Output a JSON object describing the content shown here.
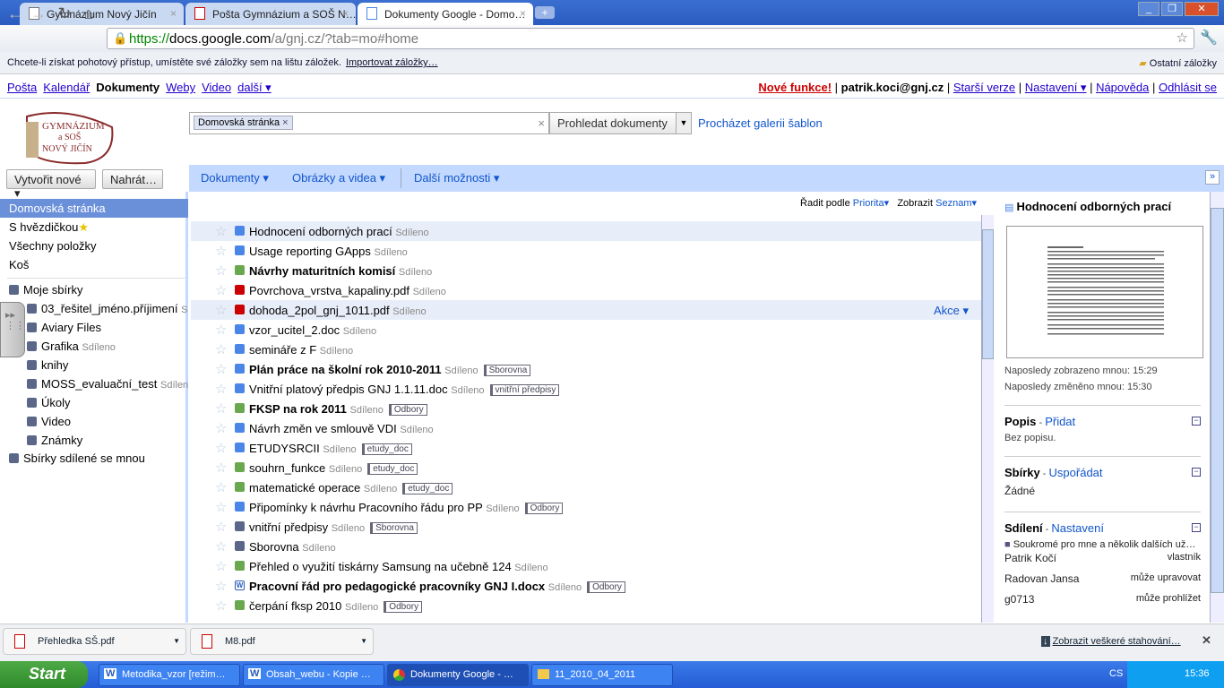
{
  "browser": {
    "tabs": [
      {
        "title": "Gymnázium Nový Jičín",
        "icon": "page-icon"
      },
      {
        "title": "Pošta Gymnázium a SOŠ N…",
        "icon": "gmail-icon"
      },
      {
        "title": "Dokumenty Google - Domo…",
        "icon": "docs-icon"
      }
    ],
    "url": {
      "scheme": "https://",
      "host": "docs.google.com",
      "path": "/a/gnj.cz/?tab=mo#home"
    },
    "bookmark_bar": {
      "text": "Chcete-li získat pohotový přístup, umístěte své záložky sem na lištu záložek.",
      "import": "Importovat záložky…",
      "other": "Ostatní záložky"
    }
  },
  "gbar": {
    "left": [
      "Pošta",
      "Kalendář",
      "Dokumenty",
      "Weby",
      "Video",
      "další ▾"
    ],
    "new": "Nové funkce!",
    "user": "patrik.koci@gnj.cz",
    "links": [
      "Starší verze",
      "Nastavení ▾",
      "Nápověda",
      "Odhlásit se"
    ]
  },
  "logo": {
    "text": "GYMNÁZIUM a SOŠ NOVÝ JIČÍN"
  },
  "search": {
    "chip": "Domovská stránka",
    "button": "Prohledat dokumenty",
    "gallery": "Procházet galerii šablon"
  },
  "actions": {
    "create": "Vytvořit nové ▾",
    "upload": "Nahrát…"
  },
  "menus": [
    "Dokumenty ▾",
    "Obrázky a videa ▾",
    "Další možnosti ▾"
  ],
  "sidebar": {
    "items": [
      "Domovská stránka",
      "S hvězdičkou",
      "Všechny položky",
      "Koš"
    ],
    "collections_title": "Moje sbírky",
    "collections": [
      {
        "name": "03_řešitel_jméno.příjimení",
        "shared": "S"
      },
      {
        "name": "Aviary Files",
        "shared": ""
      },
      {
        "name": "Grafika",
        "shared": "Sdíleno"
      },
      {
        "name": "knihy",
        "shared": ""
      },
      {
        "name": "MOSS_evaluační_test",
        "shared": "Sdílen"
      },
      {
        "name": "Úkoly",
        "shared": ""
      },
      {
        "name": "Video",
        "shared": ""
      },
      {
        "name": "Známky",
        "shared": ""
      }
    ],
    "shared_with_me": "Sbírky sdílené se mnou"
  },
  "list": {
    "sort_label": "Řadit podle",
    "sort_value": "Priorita▾",
    "view_label": "Zobrazit",
    "view_value": "Seznam▾",
    "row_action": "Akce ▾",
    "shared_label": "Sdíleno",
    "rows": [
      {
        "name": "Hodnocení odborných prací",
        "type": "doc",
        "bold": false,
        "tag": ""
      },
      {
        "name": "Usage reporting GApps",
        "type": "doc",
        "bold": false,
        "tag": ""
      },
      {
        "name": "Návrhy maturitních komisí",
        "type": "sheet",
        "bold": true,
        "tag": ""
      },
      {
        "name": "Povrchova_vrstva_kapaliny.pdf",
        "type": "pdf",
        "bold": false,
        "tag": ""
      },
      {
        "name": "dohoda_2pol_gnj_1011.pdf",
        "type": "pdf",
        "bold": false,
        "tag": ""
      },
      {
        "name": "vzor_ucitel_2.doc",
        "type": "doc",
        "bold": false,
        "tag": ""
      },
      {
        "name": "semináře z F",
        "type": "doc",
        "bold": false,
        "tag": ""
      },
      {
        "name": "Plán práce na školní rok 2010-2011",
        "type": "doc",
        "bold": true,
        "tag": "Sborovna"
      },
      {
        "name": "Vnitřní platový předpis GNJ 1.1.11.doc",
        "type": "doc",
        "bold": false,
        "tag": "vnitřní předpisy"
      },
      {
        "name": "FKSP na rok 2011",
        "type": "sheet",
        "bold": true,
        "tag": "Odbory"
      },
      {
        "name": "Návrh změn ve smlouvě VDI",
        "type": "doc",
        "bold": false,
        "tag": ""
      },
      {
        "name": "ETUDYSRCII",
        "type": "doc",
        "bold": false,
        "tag": "etudy_doc"
      },
      {
        "name": "souhrn_funkce",
        "type": "sheet",
        "bold": false,
        "tag": "etudy_doc"
      },
      {
        "name": "matematické operace",
        "type": "sheet",
        "bold": false,
        "tag": "etudy_doc"
      },
      {
        "name": "Připomínky k návrhu Pracovního řádu pro PP",
        "type": "doc",
        "bold": false,
        "tag": "Odbory"
      },
      {
        "name": "vnitřní předpisy",
        "type": "folder",
        "bold": false,
        "tag": "Sborovna"
      },
      {
        "name": "Sborovna",
        "type": "folder",
        "bold": false,
        "tag": ""
      },
      {
        "name": "Přehled o využití tiskárny Samsung na učebně 124",
        "type": "form",
        "bold": false,
        "tag": ""
      },
      {
        "name": "Pracovní řád pro pedagogické pracovníky GNJ I.docx",
        "type": "word",
        "bold": true,
        "tag": "Odbory"
      },
      {
        "name": "čerpání fksp 2010",
        "type": "sheet",
        "bold": false,
        "tag": "Odbory"
      }
    ]
  },
  "details": {
    "title": "Hodnocení odborných prací",
    "viewed": "Naposledy zobrazeno mnou: 15:29",
    "modified": "Naposledy změněno mnou: 15:30",
    "desc_title": "Popis",
    "desc_link": "Přidat",
    "desc_value": "Bez popisu.",
    "coll_title": "Sbírky",
    "coll_link": "Uspořádat",
    "coll_value": "Žádné",
    "share_title": "Sdílení",
    "share_link": "Nastavení",
    "privacy": "Soukromé pro mne a několik dalších už…",
    "people": [
      {
        "name": "Patrik Kočí",
        "role": "vlastník"
      },
      {
        "name": "Radovan Jansa",
        "role": "může upravovat"
      },
      {
        "name": "g0713",
        "role": "může prohlížet"
      }
    ]
  },
  "downloads": {
    "items": [
      "Přehledka SŠ.pdf",
      "M8.pdf"
    ],
    "show_all": "Zobrazit veškeré stahování…"
  },
  "taskbar": {
    "start": "Start",
    "tasks": [
      "Metodika_vzor [režim…",
      "Obsah_webu - Kopie …",
      "Dokumenty Google - …",
      "11_2010_04_2011"
    ],
    "lang": "CS",
    "clock": "15:36"
  },
  "colors": {
    "accent": "#c3d9ff",
    "link": "#1155cc",
    "selected": "#6b90da",
    "doc": "#4a86e8",
    "sheet": "#6aa84f",
    "pdf": "#cc0000",
    "folder": "#5a6788"
  }
}
